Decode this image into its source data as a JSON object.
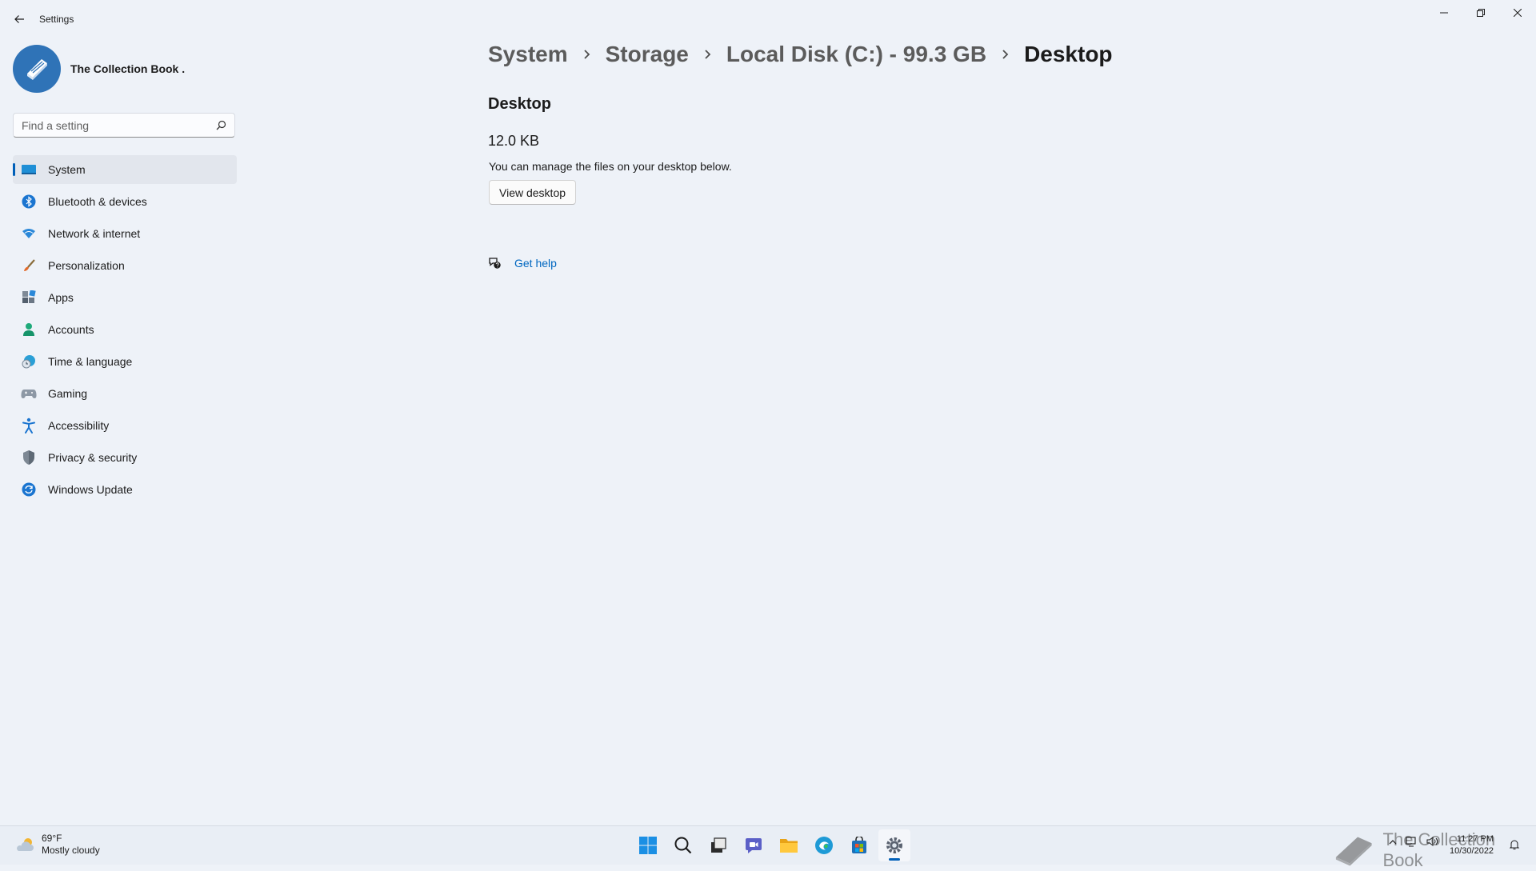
{
  "window": {
    "app_title": "Settings"
  },
  "profile": {
    "name": "The Collection Book ."
  },
  "search": {
    "placeholder": "Find a setting"
  },
  "nav": {
    "items": [
      {
        "label": "System",
        "icon": "system-icon"
      },
      {
        "label": "Bluetooth & devices",
        "icon": "bluetooth-icon"
      },
      {
        "label": "Network & internet",
        "icon": "network-icon"
      },
      {
        "label": "Personalization",
        "icon": "brush-icon"
      },
      {
        "label": "Apps",
        "icon": "apps-icon"
      },
      {
        "label": "Accounts",
        "icon": "accounts-icon"
      },
      {
        "label": "Time & language",
        "icon": "time-language-icon"
      },
      {
        "label": "Gaming",
        "icon": "gaming-icon"
      },
      {
        "label": "Accessibility",
        "icon": "accessibility-icon"
      },
      {
        "label": "Privacy & security",
        "icon": "shield-icon"
      },
      {
        "label": "Windows Update",
        "icon": "update-icon"
      }
    ],
    "active_index": 0
  },
  "breadcrumb": {
    "items": [
      "System",
      "Storage",
      "Local Disk (C:) - 99.3 GB",
      "Desktop"
    ]
  },
  "main": {
    "section_title": "Desktop",
    "size": "12.0 KB",
    "description": "You can manage the files on your desktop below.",
    "view_button": "View desktop",
    "help_label": "Get help"
  },
  "taskbar": {
    "weather": {
      "temp": "69°F",
      "condition": "Mostly cloudy"
    },
    "clock": {
      "time": "11:27 PM",
      "date": "10/30/2022"
    },
    "watermark": "The Collection Book"
  },
  "colors": {
    "accent": "#005fb8",
    "link": "#0067c0",
    "background": "#eef2f8"
  }
}
